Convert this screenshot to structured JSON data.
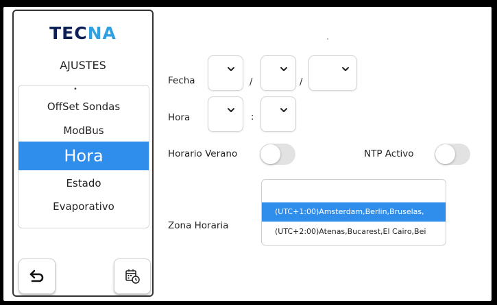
{
  "logo": {
    "part1": "TEC",
    "part2": "NA"
  },
  "sidebar": {
    "title": "AJUSTES",
    "items": [
      {
        "label": "OffSet Sondas"
      },
      {
        "label": "ModBus"
      },
      {
        "label": "Hora",
        "selected": true
      },
      {
        "label": "Estado"
      },
      {
        "label": "Evaporativo"
      }
    ],
    "back_icon": "back-arrow-icon",
    "calendar_icon": "calendar-clock-icon"
  },
  "form": {
    "fecha_label": "Fecha",
    "date_separator": "/",
    "hora_label": "Hora",
    "time_separator": ":",
    "dst_label": "Horario Verano",
    "dst_on": false,
    "ntp_label": "NTP Activo",
    "ntp_on": false,
    "tz_label": "Zona Horaria",
    "tz_options": [
      {
        "text": "(UTC+1:00)Amsterdam,Berlin,Bruselas,",
        "selected": true
      },
      {
        "text": "(UTC+2:00)Atenas,Bucarest,El Cairo,Bei",
        "selected": false
      }
    ]
  },
  "colors": {
    "accent": "#2f8dec",
    "logo_dark": "#0d1f55",
    "logo_light": "#2fa0e0"
  }
}
